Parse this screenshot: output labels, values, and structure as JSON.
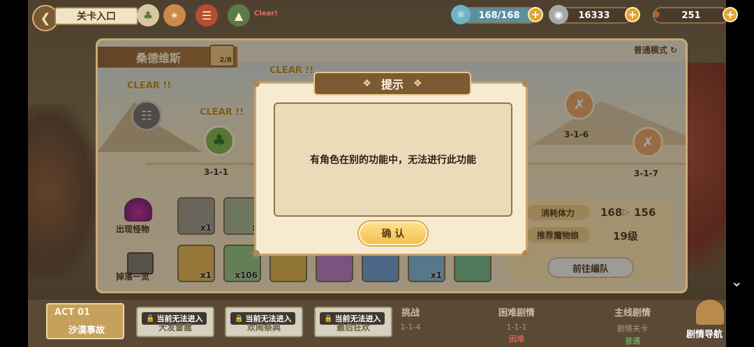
{
  "top_bar": {
    "back_icon": "heart-back-icon",
    "stage_entrance_label": "关卡入口",
    "clear_tag": "Clear!",
    "resources": {
      "stamina": {
        "value": "168/168",
        "icon": "stamina-potion-icon"
      },
      "coins": {
        "value": "16333",
        "icon": "coin-icon"
      },
      "carrots": {
        "value": "251",
        "icon": "carrot-icon"
      }
    }
  },
  "map": {
    "region_name": "桑德维斯",
    "progress": "2/8",
    "mode_label": "普通模式",
    "clear_label": "CLEAR !!",
    "stages": [
      {
        "label": "3-1-1",
        "state": "cleared"
      },
      {
        "label": "3-1-6",
        "state": "locked"
      },
      {
        "label": "3-1-7",
        "state": "locked"
      }
    ],
    "monsters_label": "出现怪物",
    "drops_label": "掉落一览",
    "monster_cards": [
      {
        "count": "x1"
      },
      {
        "count": "x"
      }
    ],
    "drop_cards": [
      {
        "count": "x1"
      },
      {
        "count": "x106"
      },
      {
        "count": ""
      },
      {
        "count": ""
      },
      {
        "count": ""
      },
      {
        "count": "x1"
      },
      {
        "count": ""
      }
    ],
    "info": {
      "stamina_cost_label": "消耗体力",
      "stamina_from": "168",
      "stamina_to": "156",
      "recommended_label": "推荐魔物娘",
      "recommended_level": "19级",
      "formation_button": "前往编队"
    }
  },
  "bottom_bar": {
    "act_label": "ACT 01",
    "act_name": "沙漠事故",
    "locked_tabs": [
      {
        "lock_text": "当前无法进入",
        "sub": "大发雷霆"
      },
      {
        "lock_text": "当前无法进入",
        "sub": "欢闹祭典"
      },
      {
        "lock_text": "当前无法进入",
        "sub": "最后狂欢"
      }
    ],
    "modes": [
      {
        "title": "挑战",
        "stage": "1-1-4",
        "difficulty": ""
      },
      {
        "title": "困难剧情",
        "stage": "1-1-1",
        "difficulty": "困难"
      },
      {
        "title": "主线剧情",
        "stage": "剧情关卡",
        "difficulty": "普通"
      }
    ],
    "guide_button": "剧情导航"
  },
  "dialog": {
    "title": "提示",
    "message": "有角色在别的功能中，无法进行此功能",
    "confirm_button": "确 认"
  },
  "colors": {
    "dialog_header": "#7c5a34",
    "confirm_button": "#f2c04f",
    "panel_bg": "#f3e6c8"
  }
}
